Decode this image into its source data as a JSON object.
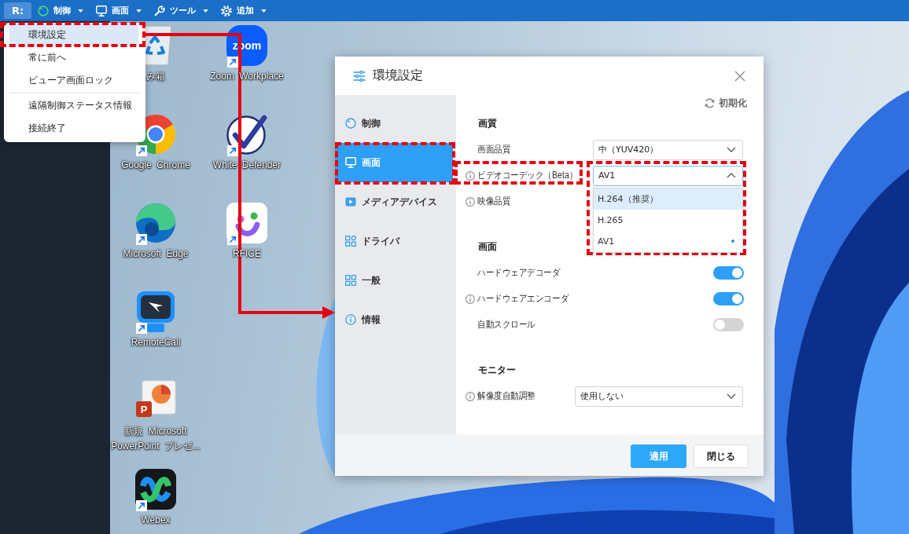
{
  "toolbar": {
    "logo": "R:",
    "menus": [
      {
        "kind": "control",
        "label": "制御"
      },
      {
        "kind": "screen",
        "label": "画面"
      },
      {
        "kind": "tools",
        "label": "ツール"
      },
      {
        "kind": "add",
        "label": "追加"
      }
    ]
  },
  "menu": {
    "items": [
      {
        "kind": "item",
        "label": "環境設定",
        "hovered": true,
        "annotated": true
      },
      {
        "kind": "item",
        "label": "常に前へ",
        "hovered": false,
        "annotated": false
      },
      {
        "kind": "item",
        "label": "ビューア画面ロック",
        "hovered": false,
        "annotated": false
      },
      {
        "kind": "separator"
      },
      {
        "kind": "item",
        "label": "遠隔制御ステータス情報",
        "hovered": false,
        "annotated": false
      },
      {
        "kind": "item",
        "label": "接続終了",
        "hovered": false,
        "annotated": false
      }
    ]
  },
  "desktop": {
    "columns": [
      {
        "icons": [
          {
            "kind": "recycle-bin",
            "label": "み箱",
            "shortcut": false
          },
          {
            "kind": "ring-browser",
            "label": "Google Chrome",
            "shortcut": true
          },
          {
            "kind": "wave-browser",
            "label": "Microsoft Edge",
            "shortcut": true
          },
          {
            "kind": "remote",
            "label": "RemoteCall",
            "shortcut": true
          },
          {
            "kind": "presentation",
            "logo_text": "P",
            "label": "新規 Microsoft PowerPoint プレゼ...",
            "shortcut": false
          },
          {
            "kind": "loops",
            "label": "Webex",
            "shortcut": true
          }
        ]
      },
      {
        "icons": [
          {
            "kind": "meeting",
            "logo_text": "zoom",
            "label": "Zoom Workplace",
            "shortcut": true
          },
          {
            "kind": "check",
            "label": "White Defender",
            "shortcut": true
          },
          {
            "kind": "smiley",
            "label": "RFICE",
            "shortcut": true
          }
        ]
      }
    ]
  },
  "dialog": {
    "title": "環境設定",
    "sidebar": [
      {
        "kind": "control",
        "label": "制御",
        "selected": false,
        "annotated": false
      },
      {
        "kind": "screen",
        "label": "画面",
        "selected": true,
        "annotated": true
      },
      {
        "kind": "media",
        "label": "メディアデバイス",
        "selected": false,
        "annotated": false
      },
      {
        "kind": "driver",
        "label": "ドライバ",
        "selected": false,
        "annotated": false
      },
      {
        "kind": "general",
        "label": "一般",
        "selected": false,
        "annotated": false
      },
      {
        "kind": "info",
        "label": "情報",
        "selected": false,
        "annotated": false
      }
    ],
    "reset": "初期化",
    "sections": [
      {
        "title": "画質",
        "rows": [
          {
            "kind": "select",
            "label": "画面品質",
            "info": false,
            "value": "中（YUV420）",
            "expanded": false,
            "annotated": false
          },
          {
            "kind": "select",
            "label": "ビデオコーデック（Beta）",
            "info": true,
            "value": "AV1",
            "expanded": true,
            "annotated": true,
            "options": [
              {
                "label": "H.264（推奨）",
                "hovered": true,
                "selected": false
              },
              {
                "label": "H.265",
                "hovered": false,
                "selected": false
              },
              {
                "label": "AV1",
                "hovered": false,
                "selected": true
              }
            ]
          },
          {
            "kind": "label",
            "label": "映像品質",
            "info": true,
            "annotated": false
          }
        ]
      },
      {
        "title": "画面",
        "rows": [
          {
            "kind": "toggle",
            "label": "ハードウェアデコーダ",
            "info": false,
            "on": true,
            "annotated": false
          },
          {
            "kind": "toggle",
            "label": "ハードウェアエンコーダ",
            "info": true,
            "on": true,
            "annotated": false
          },
          {
            "kind": "toggle",
            "label": "自動スクロール",
            "info": false,
            "on": false,
            "annotated": false
          }
        ]
      },
      {
        "title": "モニター",
        "rows": [
          {
            "kind": "select",
            "label": "解像度自動調整",
            "info": true,
            "value": "使用しない",
            "expanded": false,
            "annotated": false
          }
        ]
      }
    ],
    "buttons": [
      {
        "kind": "primary",
        "label": "適用"
      },
      {
        "kind": "secondary",
        "label": "閉じる"
      }
    ]
  },
  "annotation_arrow": true
}
